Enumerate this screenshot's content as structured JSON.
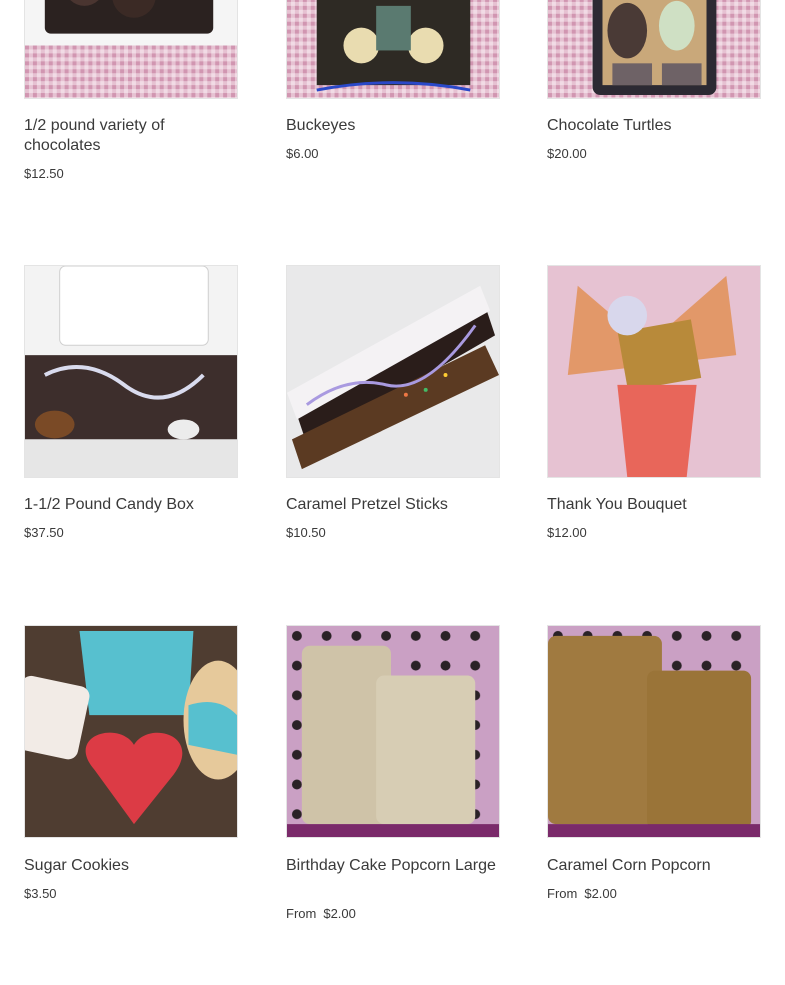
{
  "products": [
    {
      "name": "1/2 pound variety of chocolates",
      "price": "$12.50",
      "from": ""
    },
    {
      "name": "Buckeyes",
      "price": "$6.00",
      "from": ""
    },
    {
      "name": "Chocolate Turtles",
      "price": "$20.00",
      "from": ""
    },
    {
      "name": "1-1/2 Pound Candy Box",
      "price": "$37.50",
      "from": ""
    },
    {
      "name": "Caramel Pretzel Sticks",
      "price": "$10.50",
      "from": ""
    },
    {
      "name": "Thank You Bouquet",
      "price": "$12.00",
      "from": ""
    },
    {
      "name": "Sugar Cookies",
      "price": "$3.50",
      "from": ""
    },
    {
      "name": "Birthday Cake Popcorn Large",
      "price": "$2.00",
      "from": "From"
    },
    {
      "name": "Caramel Corn Popcorn",
      "price": "$2.00",
      "from": "From"
    }
  ],
  "colors": {
    "text": "#3a3a3a",
    "checkered": "#d9a6bd",
    "border": "#e4e4e4"
  }
}
